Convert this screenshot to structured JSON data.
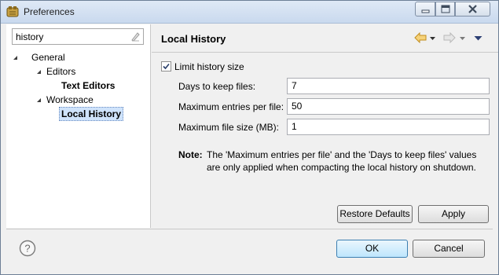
{
  "window": {
    "title": "Preferences"
  },
  "filter": {
    "value": "history"
  },
  "tree": {
    "general": "General",
    "editors": "Editors",
    "text_editors": "Text Editors",
    "workspace": "Workspace",
    "local_history": "Local History"
  },
  "page": {
    "title": "Local History",
    "limit_checkbox": {
      "label": "Limit history size",
      "checked": true
    },
    "fields": [
      {
        "label": "Days to keep files:",
        "value": "7"
      },
      {
        "label": "Maximum entries per file:",
        "value": "50"
      },
      {
        "label": "Maximum file size (MB):",
        "value": "1"
      }
    ],
    "note_label": "Note:",
    "note_text": "The 'Maximum entries per file' and the 'Days to keep files' values are only applied when compacting the local history on shutdown."
  },
  "buttons": {
    "restore_defaults": "Restore Defaults",
    "apply": "Apply",
    "ok": "OK",
    "cancel": "Cancel"
  },
  "icons": {
    "app": "eclipse-preferences-icon",
    "back": "back-arrow-icon",
    "forward": "forward-arrow-icon",
    "menu": "view-menu-icon",
    "help": "help-icon",
    "clear": "clear-filter-icon"
  },
  "colors": {
    "nav_arrow": "#e8b44a",
    "selection": "#cfe3fb",
    "default_button": "#3c7fb1"
  }
}
